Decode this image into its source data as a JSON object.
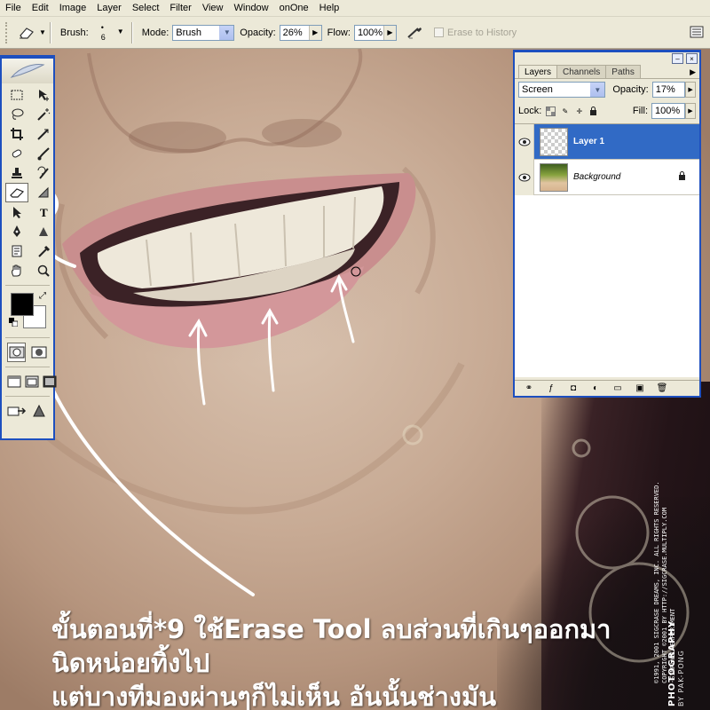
{
  "menu": [
    "File",
    "Edit",
    "Image",
    "Layer",
    "Select",
    "Filter",
    "View",
    "Window",
    "onOne",
    "Help"
  ],
  "options_bar": {
    "brush_label": "Brush:",
    "brush_size": "6",
    "mode_label": "Mode:",
    "mode_value": "Brush",
    "opacity_label": "Opacity:",
    "opacity_value": "26%",
    "flow_label": "Flow:",
    "flow_value": "100%",
    "erase_to_history_label": "Erase to History"
  },
  "layers_panel": {
    "tabs": [
      "Layers",
      "Channels",
      "Paths"
    ],
    "active_tab": "Layers",
    "blend_mode": "Screen",
    "opacity_label": "Opacity:",
    "opacity_value": "17%",
    "lock_label": "Lock:",
    "fill_label": "Fill:",
    "fill_value": "100%",
    "layers": [
      {
        "name": "Layer 1",
        "selected": true,
        "visible": true
      },
      {
        "name": "Background",
        "selected": false,
        "visible": true,
        "locked": true
      }
    ]
  },
  "tools_panel": {
    "active_tool": "eraser",
    "foreground_color": "#000000",
    "background_color": "#ffffff"
  },
  "caption": {
    "line1": "ขั้นตอนที่*9 ใช้Erase Tool ลบส่วนที่เกินๆออกมานิดหน่อยทิ้งไป",
    "line2": "แต่บางทีมองผ่านๆก็ไม่เห็น อันนั้นช่างมัน"
  },
  "watermark": {
    "brand_line1": "PHOTOGRAPHY",
    "brand_line2": "BY PAK-PONG",
    "copyright_lines": [
      "©1991, 2001 SIGCRASE DREAMS, INC. ALL RIGHTS RESERVED.",
      "COPYRIGHT ©2001 BY HTTP://SIGCRASE.MULTIPLY.COM",
      "-SIMPLYOL EXPERIMENT"
    ]
  },
  "colors": {
    "panel_bg": "#ece9d8",
    "panel_border": "#1d4fbf",
    "selection": "#316ac5"
  }
}
